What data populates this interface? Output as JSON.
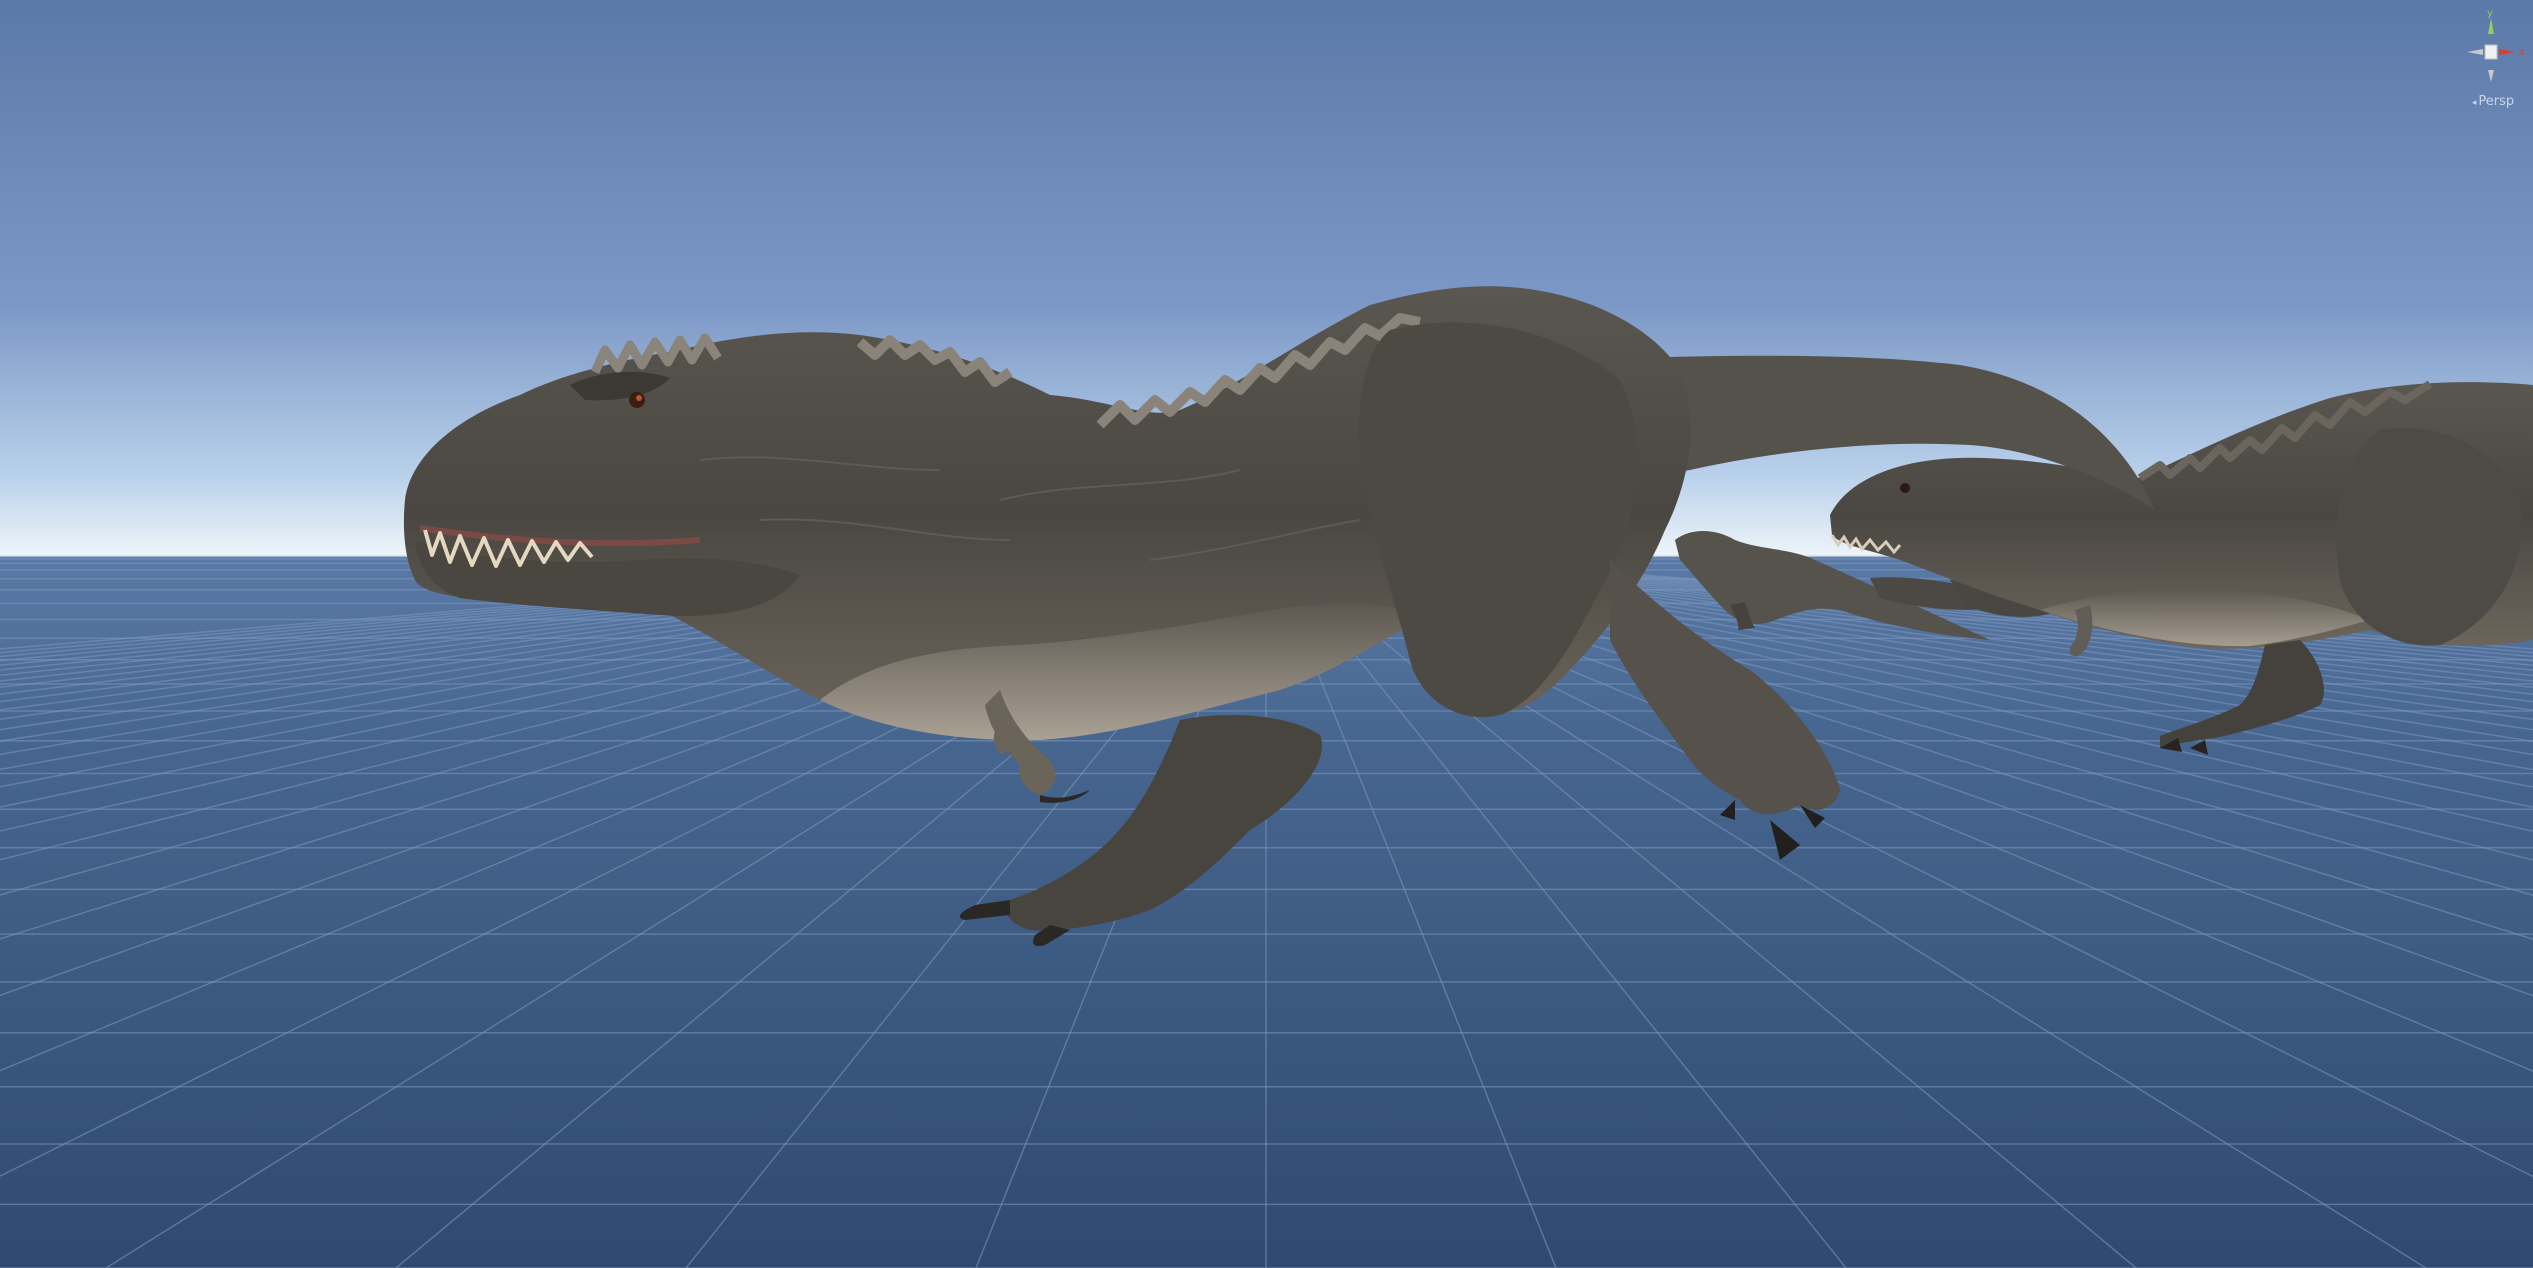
{
  "viewport": {
    "projection_label": "Persp",
    "projection_icon": "speaker-icon",
    "axis_label_y": "y",
    "axis_label_x": "x",
    "colors": {
      "sky_top": "#5b79a8",
      "horizon_glow": "#eef5fa",
      "ground": "#3c5980",
      "grid_line": "#7d97bd",
      "dino_skin": "#4f4c47",
      "dino_belly": "#b9b0a2",
      "axis_x": "#e03a2f",
      "axis_y": "#8cd35a",
      "axis_z": "#c9c9c9"
    }
  }
}
